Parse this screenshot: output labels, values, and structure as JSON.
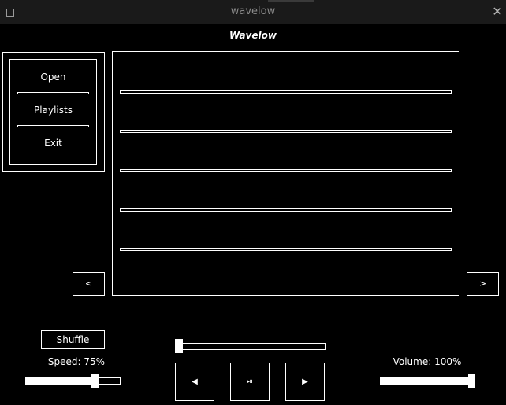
{
  "window": {
    "title": "wavelow"
  },
  "app": {
    "title": "Wavelow"
  },
  "menu": {
    "items": [
      "Open",
      "Playlists",
      "Exit"
    ]
  },
  "playlist": {
    "rows": 5,
    "prev_label": "<",
    "next_label": ">"
  },
  "controls": {
    "shuffle_label": "Shuffle",
    "speed_label": "Speed: 75%",
    "speed_value": 0.75,
    "volume_label": "Volume: 100%",
    "volume_value": 1.0,
    "seek_value": 0.0,
    "prev_label": "◀",
    "playpause_label": "⏯",
    "next_label": "▶"
  },
  "icons": {
    "restore": "restore-window-icon",
    "close": "close-icon"
  },
  "colors": {
    "background": "#000000",
    "foreground": "#ffffff",
    "titlebar": "#1a1a1a"
  }
}
